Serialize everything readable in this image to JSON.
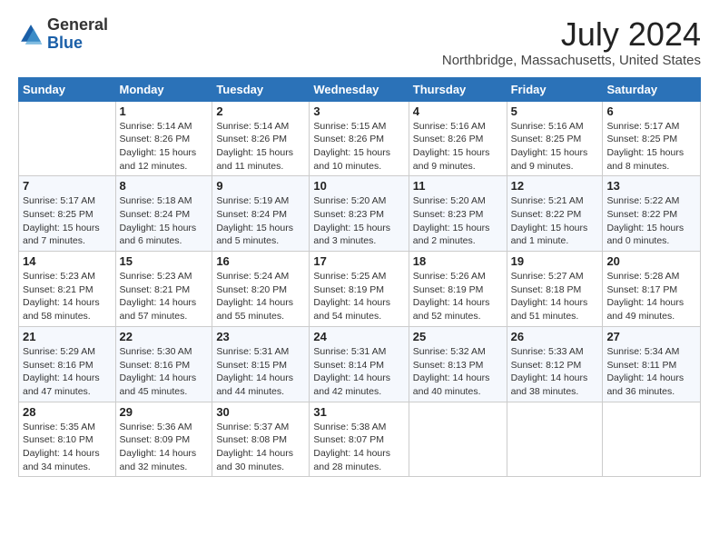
{
  "logo": {
    "general": "General",
    "blue": "Blue"
  },
  "title": "July 2024",
  "subtitle": "Northbridge, Massachusetts, United States",
  "weekdays": [
    "Sunday",
    "Monday",
    "Tuesday",
    "Wednesday",
    "Thursday",
    "Friday",
    "Saturday"
  ],
  "weeks": [
    [
      {
        "day": "",
        "info": ""
      },
      {
        "day": "1",
        "info": "Sunrise: 5:14 AM\nSunset: 8:26 PM\nDaylight: 15 hours\nand 12 minutes."
      },
      {
        "day": "2",
        "info": "Sunrise: 5:14 AM\nSunset: 8:26 PM\nDaylight: 15 hours\nand 11 minutes."
      },
      {
        "day": "3",
        "info": "Sunrise: 5:15 AM\nSunset: 8:26 PM\nDaylight: 15 hours\nand 10 minutes."
      },
      {
        "day": "4",
        "info": "Sunrise: 5:16 AM\nSunset: 8:26 PM\nDaylight: 15 hours\nand 9 minutes."
      },
      {
        "day": "5",
        "info": "Sunrise: 5:16 AM\nSunset: 8:25 PM\nDaylight: 15 hours\nand 9 minutes."
      },
      {
        "day": "6",
        "info": "Sunrise: 5:17 AM\nSunset: 8:25 PM\nDaylight: 15 hours\nand 8 minutes."
      }
    ],
    [
      {
        "day": "7",
        "info": "Sunrise: 5:17 AM\nSunset: 8:25 PM\nDaylight: 15 hours\nand 7 minutes."
      },
      {
        "day": "8",
        "info": "Sunrise: 5:18 AM\nSunset: 8:24 PM\nDaylight: 15 hours\nand 6 minutes."
      },
      {
        "day": "9",
        "info": "Sunrise: 5:19 AM\nSunset: 8:24 PM\nDaylight: 15 hours\nand 5 minutes."
      },
      {
        "day": "10",
        "info": "Sunrise: 5:20 AM\nSunset: 8:23 PM\nDaylight: 15 hours\nand 3 minutes."
      },
      {
        "day": "11",
        "info": "Sunrise: 5:20 AM\nSunset: 8:23 PM\nDaylight: 15 hours\nand 2 minutes."
      },
      {
        "day": "12",
        "info": "Sunrise: 5:21 AM\nSunset: 8:22 PM\nDaylight: 15 hours\nand 1 minute."
      },
      {
        "day": "13",
        "info": "Sunrise: 5:22 AM\nSunset: 8:22 PM\nDaylight: 15 hours\nand 0 minutes."
      }
    ],
    [
      {
        "day": "14",
        "info": "Sunrise: 5:23 AM\nSunset: 8:21 PM\nDaylight: 14 hours\nand 58 minutes."
      },
      {
        "day": "15",
        "info": "Sunrise: 5:23 AM\nSunset: 8:21 PM\nDaylight: 14 hours\nand 57 minutes."
      },
      {
        "day": "16",
        "info": "Sunrise: 5:24 AM\nSunset: 8:20 PM\nDaylight: 14 hours\nand 55 minutes."
      },
      {
        "day": "17",
        "info": "Sunrise: 5:25 AM\nSunset: 8:19 PM\nDaylight: 14 hours\nand 54 minutes."
      },
      {
        "day": "18",
        "info": "Sunrise: 5:26 AM\nSunset: 8:19 PM\nDaylight: 14 hours\nand 52 minutes."
      },
      {
        "day": "19",
        "info": "Sunrise: 5:27 AM\nSunset: 8:18 PM\nDaylight: 14 hours\nand 51 minutes."
      },
      {
        "day": "20",
        "info": "Sunrise: 5:28 AM\nSunset: 8:17 PM\nDaylight: 14 hours\nand 49 minutes."
      }
    ],
    [
      {
        "day": "21",
        "info": "Sunrise: 5:29 AM\nSunset: 8:16 PM\nDaylight: 14 hours\nand 47 minutes."
      },
      {
        "day": "22",
        "info": "Sunrise: 5:30 AM\nSunset: 8:16 PM\nDaylight: 14 hours\nand 45 minutes."
      },
      {
        "day": "23",
        "info": "Sunrise: 5:31 AM\nSunset: 8:15 PM\nDaylight: 14 hours\nand 44 minutes."
      },
      {
        "day": "24",
        "info": "Sunrise: 5:31 AM\nSunset: 8:14 PM\nDaylight: 14 hours\nand 42 minutes."
      },
      {
        "day": "25",
        "info": "Sunrise: 5:32 AM\nSunset: 8:13 PM\nDaylight: 14 hours\nand 40 minutes."
      },
      {
        "day": "26",
        "info": "Sunrise: 5:33 AM\nSunset: 8:12 PM\nDaylight: 14 hours\nand 38 minutes."
      },
      {
        "day": "27",
        "info": "Sunrise: 5:34 AM\nSunset: 8:11 PM\nDaylight: 14 hours\nand 36 minutes."
      }
    ],
    [
      {
        "day": "28",
        "info": "Sunrise: 5:35 AM\nSunset: 8:10 PM\nDaylight: 14 hours\nand 34 minutes."
      },
      {
        "day": "29",
        "info": "Sunrise: 5:36 AM\nSunset: 8:09 PM\nDaylight: 14 hours\nand 32 minutes."
      },
      {
        "day": "30",
        "info": "Sunrise: 5:37 AM\nSunset: 8:08 PM\nDaylight: 14 hours\nand 30 minutes."
      },
      {
        "day": "31",
        "info": "Sunrise: 5:38 AM\nSunset: 8:07 PM\nDaylight: 14 hours\nand 28 minutes."
      },
      {
        "day": "",
        "info": ""
      },
      {
        "day": "",
        "info": ""
      },
      {
        "day": "",
        "info": ""
      }
    ]
  ]
}
